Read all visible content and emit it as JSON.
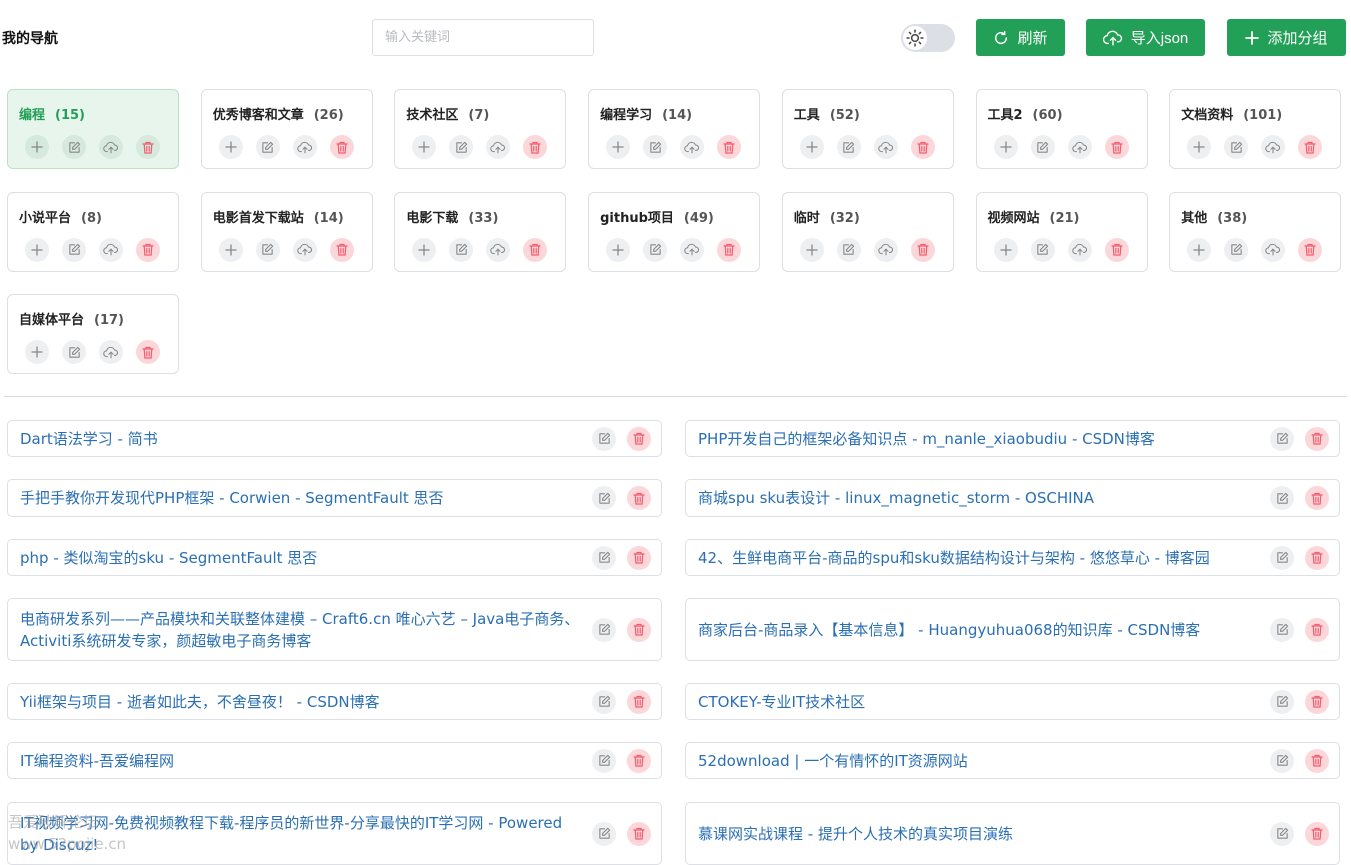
{
  "app": {
    "title": "我的导航"
  },
  "search": {
    "placeholder": "输入关键词",
    "value": ""
  },
  "theme_toggle": {
    "icon": "sun-icon",
    "state": "light"
  },
  "toolbar": {
    "refresh_label": "刷新",
    "import_label": "导入json",
    "add_group_label": "添加分组"
  },
  "colors": {
    "accent": "#23a057",
    "link": "#2a6fb4",
    "danger": "#f56c7d"
  },
  "groups": [
    {
      "name": "编程",
      "count": "(15)",
      "active": true
    },
    {
      "name": "优秀博客和文章",
      "count": "(26)"
    },
    {
      "name": "技术社区",
      "count": "(7)"
    },
    {
      "name": "编程学习",
      "count": "(14)"
    },
    {
      "name": "工具",
      "count": "(52)"
    },
    {
      "name": "工具2",
      "count": "(60)"
    },
    {
      "name": "文档资料",
      "count": "(101)"
    },
    {
      "name": "小说平台",
      "count": "(8)"
    },
    {
      "name": "电影首发下载站",
      "count": "(14)"
    },
    {
      "name": "电影下载",
      "count": "(33)"
    },
    {
      "name": "github项目",
      "count": "(49)"
    },
    {
      "name": "临时",
      "count": "(32)"
    },
    {
      "name": "视频网站",
      "count": "(21)"
    },
    {
      "name": "其他",
      "count": "(38)"
    },
    {
      "name": "自媒体平台",
      "count": "(17)"
    }
  ],
  "links": [
    {
      "title": "Dart语法学习 - 简书"
    },
    {
      "title": "PHP开发自己的框架必备知识点 - m_nanle_xiaobudiu - CSDN博客"
    },
    {
      "title": "手把手教你开发现代PHP框架 - Corwien - SegmentFault 思否"
    },
    {
      "title": "商城spu sku表设计 - linux_magnetic_storm - OSCHINA"
    },
    {
      "title": "php - 类似淘宝的sku - SegmentFault 思否"
    },
    {
      "title": "42、生鲜电商平台-商品的spu和sku数据结构设计与架构 - 悠悠草心 - 博客园"
    },
    {
      "title": "电商研发系列——产品模块和关联整体建模 – Craft6.cn 唯心六艺 – Java电子商务、Activiti系统研发专家，颜超敏电子商务博客"
    },
    {
      "title": "商家后台-商品录入【基本信息】 - Huangyuhua068的知识库 - CSDN博客"
    },
    {
      "title": "Yii框架与项目 - 逝者如此夫，不舍昼夜！ - CSDN博客"
    },
    {
      "title": "CTOKEY-专业IT技术社区"
    },
    {
      "title": "IT编程资料-吾爱编程网"
    },
    {
      "title": "52download | 一个有情怀的IT资源网站"
    },
    {
      "title": "IT视频学习网-免费视频教程下载-程序员的新世界-分享最快的IT学习网 - Powered by Discuz!"
    },
    {
      "title": "慕课网实战课程 - 提升个人技术的真实项目演练"
    }
  ],
  "watermark": "吾爱破解论坛\nwww.52pojie.cn"
}
